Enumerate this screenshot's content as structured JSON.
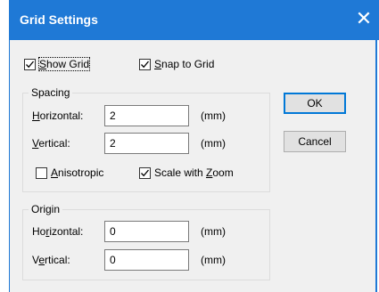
{
  "window": {
    "title": "Grid Settings",
    "close_glyph": "✕"
  },
  "options": {
    "show_grid": {
      "label_pre": "",
      "label_key": "S",
      "label_post": "how Grid",
      "checked": true
    },
    "snap_to_grid": {
      "label_pre": "",
      "label_key": "S",
      "label_post": "nap to Grid",
      "checked": true
    }
  },
  "spacing": {
    "title": "Spacing",
    "horizontal": {
      "label_pre": "",
      "label_key": "H",
      "label_post": "orizontal:",
      "value": "2",
      "unit": "(mm)"
    },
    "vertical": {
      "label_pre": "",
      "label_key": "V",
      "label_post": "ertical:",
      "value": "2",
      "unit": "(mm)"
    },
    "anisotropic": {
      "label_pre": "",
      "label_key": "A",
      "label_post": "nisotropic",
      "checked": false
    },
    "scale_with_zoom": {
      "label_pre": "Scale with ",
      "label_key": "Z",
      "label_post": "oom",
      "checked": true
    }
  },
  "origin": {
    "title": "Origin",
    "horizontal": {
      "label_pre": "Ho",
      "label_key": "r",
      "label_post": "izontal:",
      "value": "0",
      "unit": "(mm)"
    },
    "vertical": {
      "label_pre": "V",
      "label_key": "e",
      "label_post": "rtical:",
      "value": "0",
      "unit": "(mm)"
    }
  },
  "buttons": {
    "ok": "OK",
    "cancel": "Cancel"
  },
  "colors": {
    "titlebar": "#1f79d6",
    "button_focus": "#0078d7"
  }
}
